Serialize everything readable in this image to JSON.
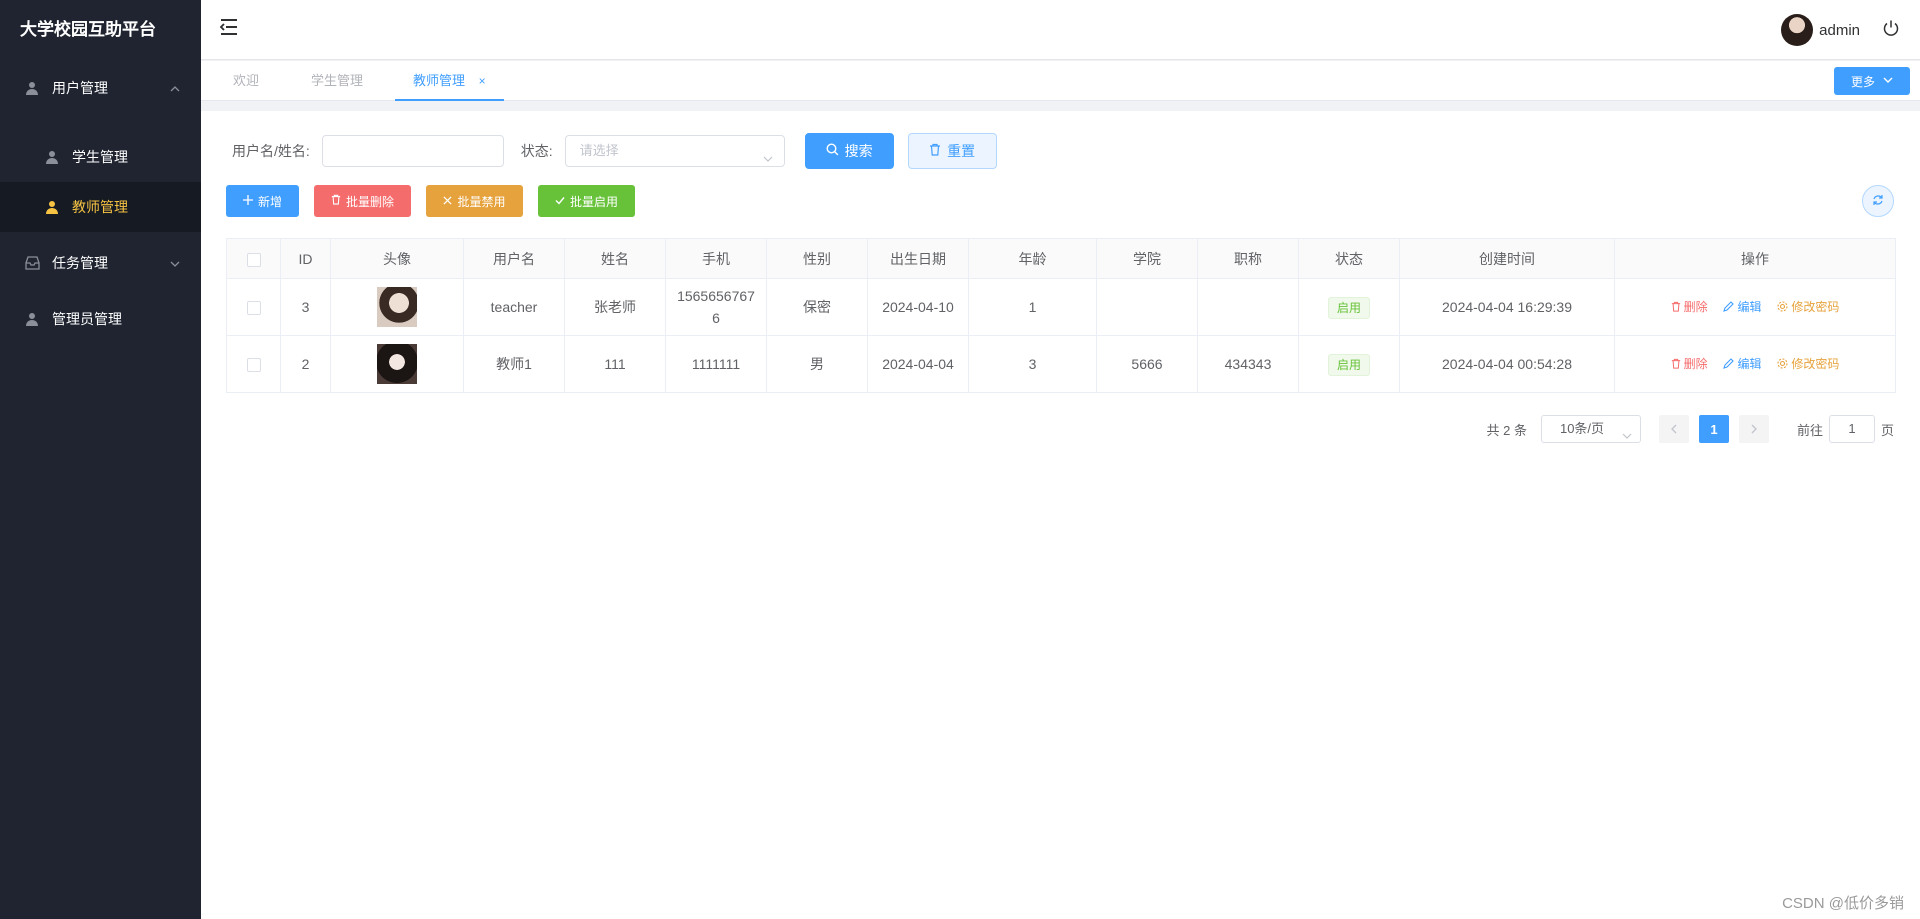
{
  "app_title": "大学校园互助平台",
  "sidebar": {
    "user_mgmt": "用户管理",
    "student_mgmt": "学生管理",
    "teacher_mgmt": "教师管理",
    "task_mgmt": "任务管理",
    "admin_mgmt": "管理员管理"
  },
  "header": {
    "username": "admin"
  },
  "tabs": {
    "welcome": "欢迎",
    "student": "学生管理",
    "teacher": "教师管理",
    "close": "×",
    "more": "更多"
  },
  "search": {
    "name_label": "用户名/姓名:",
    "status_label": "状态:",
    "status_placeholder": "请选择",
    "search_btn": "搜索",
    "reset_btn": "重置"
  },
  "actions": {
    "add": "新增",
    "batch_delete": "批量删除",
    "batch_disable": "批量禁用",
    "batch_enable": "批量启用"
  },
  "colors": {
    "primary": "#409eff",
    "danger": "#f56c6c",
    "warning": "#e6a23c",
    "success": "#67c23a",
    "sidebar_bg": "#1f2430",
    "active_menu": "#f6c343"
  },
  "table": {
    "headers": [
      "ID",
      "头像",
      "用户名",
      "姓名",
      "手机",
      "性别",
      "出生日期",
      "年龄",
      "学院",
      "职称",
      "状态",
      "创建时间",
      "操作"
    ],
    "rows": [
      {
        "id": "3",
        "username": "teacher",
        "name": "张老师",
        "phone": "15656567676",
        "gender": "保密",
        "birth": "2024-04-10",
        "age": "1",
        "college": "",
        "title": "",
        "status": "启用",
        "created": "2024-04-04 16:29:39"
      },
      {
        "id": "2",
        "username": "教师1",
        "name": "111",
        "phone": "1111111",
        "gender": "男",
        "birth": "2024-04-04",
        "age": "3",
        "college": "5666",
        "title": "434343",
        "status": "启用",
        "created": "2024-04-04 00:54:28"
      }
    ],
    "ops": {
      "delete": "删除",
      "edit": "编辑",
      "change_pwd": "修改密码"
    }
  },
  "pagination": {
    "total": "共 2 条",
    "page_size": "10条/页",
    "current": "1",
    "goto": "前往",
    "goto_value": "1",
    "page_unit": "页"
  },
  "watermark": "CSDN @低价多销"
}
